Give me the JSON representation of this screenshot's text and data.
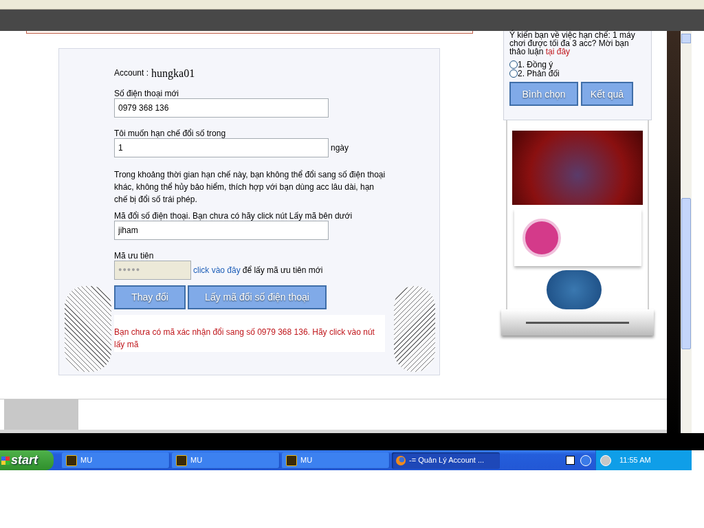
{
  "account": {
    "label": "Account :",
    "value": "hungka01"
  },
  "phone": {
    "label": "Số điện thoại mới",
    "value": "0979 368 136"
  },
  "limit": {
    "label": "Tôi muốn hạn chế đổi số trong",
    "value": "1",
    "unit": "ngày"
  },
  "note": "Trong khoảng thời gian hạn chế này, bạn không thể đổi sang số điện thoại khác, không thể hủy bảo hiểm, thích hợp với bạn dùng acc lâu dài, hạn chế bị đổi số trái phép.",
  "code": {
    "label": "Mã đổi số điện thoại. Bạn chưa có hãy click nút Lấy mã bên dưới",
    "value": "jiham"
  },
  "priority": {
    "label": "Mã ưu tiên",
    "masked_value": "●●●●●",
    "link": "click vào đây",
    "after": "để lấy mã ưu tiên mới"
  },
  "buttons": [
    "Thay đổi",
    "Lấy mã đổi số điện thoại"
  ],
  "error": "Bạn chưa có mã xác nhận đổi sang số 0979 368 136. Hãy click vào nút lấy mã",
  "poll": {
    "question": "Ý kiến bạn về việc hạn chế: 1 máy chơi được tối đa 3 acc? Mời bạn thảo luận",
    "link": "tại đây",
    "options": [
      {
        "label": "1. Đồng ý",
        "selected": false
      },
      {
        "label": "2. Phản đối",
        "selected": false
      }
    ],
    "buttons": [
      "Bình chọn",
      "Kết quả"
    ]
  },
  "taskbar": {
    "start": "start",
    "tasks": [
      {
        "kind": "game",
        "label": "MU",
        "selected": false
      },
      {
        "kind": "game",
        "label": "MU",
        "selected": false
      },
      {
        "kind": "game",
        "label": "MU",
        "selected": false
      },
      {
        "kind": "browser",
        "label": "-= Quản Lý Account ...",
        "selected": true
      }
    ],
    "clock": "11:55 AM"
  }
}
